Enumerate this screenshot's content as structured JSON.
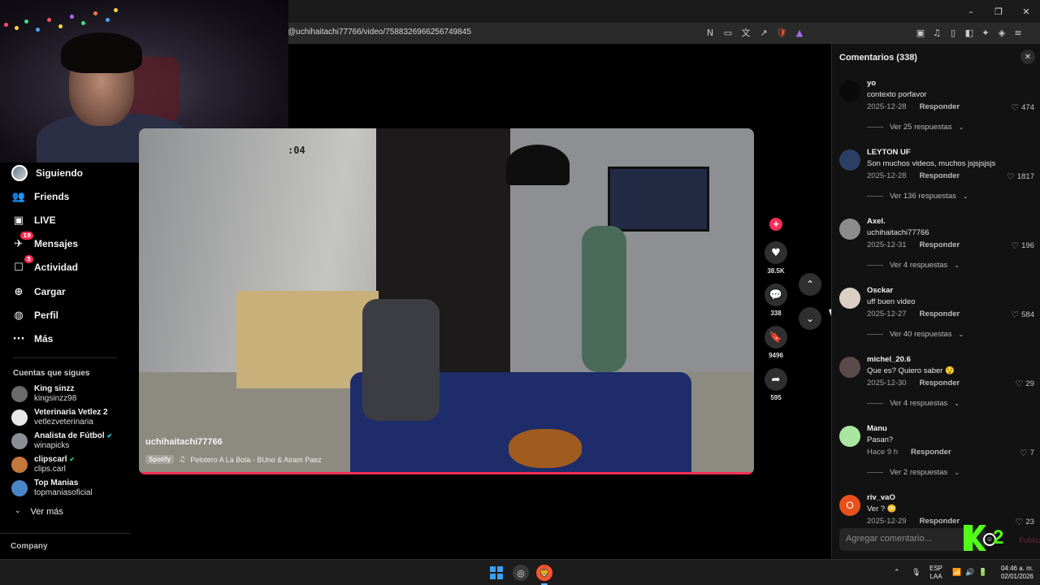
{
  "browser": {
    "url": "@uchihaitachi77766/video/7588326966256749845",
    "window_controls": {
      "minimize": "–",
      "restore": "❐",
      "close": "✕"
    },
    "address_icons": [
      "N",
      "▭",
      "文",
      "↗"
    ],
    "toolbar_icons": [
      "▣",
      "♫",
      "▯",
      "◧",
      "✦",
      "◈",
      "≡"
    ]
  },
  "sidebar": {
    "nav": [
      {
        "label": "Siguiendo",
        "icon": "avatar-icon"
      },
      {
        "label": "Friends",
        "icon": "friends-icon",
        "glyph": "👥"
      },
      {
        "label": "LIVE",
        "icon": "live-icon",
        "glyph": "▣"
      },
      {
        "label": "Mensajes",
        "icon": "messages-icon",
        "glyph": "✈",
        "badge": "19"
      },
      {
        "label": "Actividad",
        "icon": "activity-icon",
        "glyph": "☐",
        "badge": "5"
      },
      {
        "label": "Cargar",
        "icon": "upload-icon",
        "glyph": "⊕"
      },
      {
        "label": "Perfil",
        "icon": "profile-icon",
        "glyph": "◍"
      },
      {
        "label": "Más",
        "icon": "more-icon",
        "glyph": "···"
      }
    ],
    "following_title": "Cuentas que sigues",
    "accounts": [
      {
        "name": "King sinzz",
        "handle": "kingsinzz98",
        "color": "#6b6b6b"
      },
      {
        "name": "Veterinaria Vetlez 2",
        "handle": "vetlezveterinaria",
        "color": "#e8e8e8"
      },
      {
        "name": "Analista de Fútbol",
        "handle": "winapicks",
        "color": "#8a8f96",
        "verified": "✔"
      },
      {
        "name": "clipscarl",
        "handle": "clips.carl",
        "color": "#c2783a",
        "verified": "✔"
      },
      {
        "name": "Top Manias",
        "handle": "topmaniasoficial",
        "color": "#4a86c9"
      }
    ],
    "see_more": "Ver más",
    "company": "Company"
  },
  "video": {
    "timestamp": ":04",
    "author": "uchihaitachi77766",
    "music_source": "Spotify",
    "music_title": "Pelotero A La Bola - BUno & Airam Paez"
  },
  "actions": {
    "likes": "38.5K",
    "comments": "338",
    "saves": "9496",
    "shares": "595"
  },
  "comments": {
    "header": "Comentarios (338)",
    "reply_label": "Responder",
    "items": [
      {
        "user": "yo",
        "text": "contexto porfavor",
        "date": "2025-12-28",
        "likes": "474",
        "more": "Ver 25 respuestas",
        "avatar_color": "#0a0a0a",
        "avatar_letter": ""
      },
      {
        "user": "LEYTON UF",
        "text": "Son muchos videos, muchos jsjsjsjsjs",
        "date": "2025-12-28",
        "likes": "1817",
        "more": "Ver 136 respuestas",
        "avatar_color": "#2b3f66",
        "avatar_letter": ""
      },
      {
        "user": "Axel.",
        "text": "uchihaitachi77766",
        "date": "2025-12-31",
        "likes": "196",
        "more": "Ver 4 respuestas",
        "avatar_color": "#8c8c8c",
        "avatar_letter": ""
      },
      {
        "user": "Osckar",
        "text": "uff buen video",
        "date": "2025-12-27",
        "likes": "584",
        "more": "Ver 40 respuestas",
        "avatar_color": "#d9cfc3",
        "avatar_letter": ""
      },
      {
        "user": "michel_20.6",
        "text": "Que es? Quiero saber 😯",
        "date": "2025-12-30",
        "likes": "29",
        "more": "Ver 4 respuestas",
        "avatar_color": "#5a4a4a",
        "avatar_letter": ""
      },
      {
        "user": "Manu",
        "text": "Pasan?",
        "date": "Hace 9 h",
        "likes": "7",
        "more": "Ver 2 respuestas",
        "avatar_color": "#a8e6a1",
        "avatar_letter": ""
      },
      {
        "user": "riv_vaO",
        "text": "Ver ? 😳",
        "date": "2025-12-29",
        "likes": "23",
        "more": "",
        "avatar_color": "#e8501c",
        "avatar_letter": "O"
      }
    ],
    "input_placeholder": "Agregar comentario...",
    "post_label": "Publicar"
  },
  "taskbar": {
    "language": "ESP",
    "layout": "LAA",
    "time": "04:46 a. m.",
    "date": "02/01/2026"
  },
  "colors": {
    "accent": "#fe2c55",
    "kick": "#53fc18"
  }
}
